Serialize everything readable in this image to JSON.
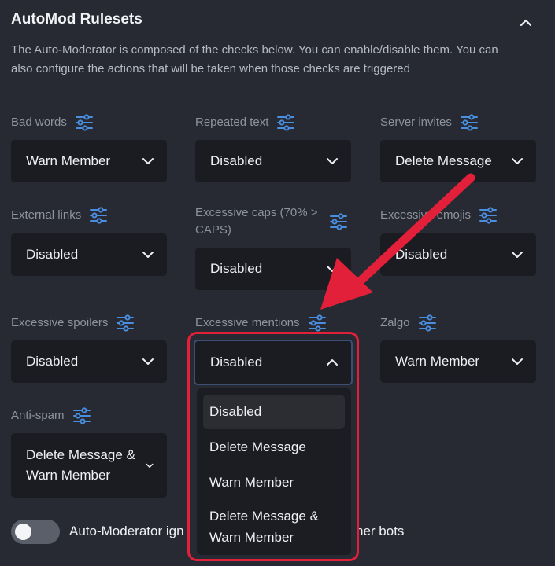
{
  "header": {
    "title": "AutoMod Rulesets",
    "description": "The Auto-Moderator is composed of the checks below. You can enable/disable them. You can also configure the actions that will be taken when those checks are triggered"
  },
  "rules": [
    {
      "id": "bad-words",
      "label": "Bad words",
      "value": "Warn Member"
    },
    {
      "id": "repeated-text",
      "label": "Repeated text",
      "value": "Disabled"
    },
    {
      "id": "server-invites",
      "label": "Server invites",
      "value": "Delete Message"
    },
    {
      "id": "external-links",
      "label": "External links",
      "value": "Disabled"
    },
    {
      "id": "excessive-caps",
      "label": "Excessive caps (70% > CAPS)",
      "value": "Disabled"
    },
    {
      "id": "excessive-emojis",
      "label": "Excessive emojis",
      "value": "Disabled"
    },
    {
      "id": "excessive-spoilers",
      "label": "Excessive spoilers",
      "value": "Disabled"
    },
    {
      "id": "excessive-mentions",
      "label": "Excessive mentions",
      "value": "Disabled"
    },
    {
      "id": "zalgo",
      "label": "Zalgo",
      "value": "Warn Member"
    },
    {
      "id": "anti-spam",
      "label": "Anti-spam",
      "value": "Delete Message & Warn Member"
    }
  ],
  "dropdown_menu": {
    "options": [
      "Disabled",
      "Delete Message",
      "Warn Member",
      "Delete Message & Warn Member"
    ],
    "selected": "Disabled"
  },
  "toggle": {
    "label_start": "Auto-Moderator ign",
    "label_end": "ner bots",
    "enabled": false
  },
  "colors": {
    "background": "#272a33",
    "dropdown": "#1b1c21",
    "icon_accent": "#4a8ee0",
    "highlight": "#e3203a"
  },
  "icons": [
    "chevron-up-icon",
    "tune-icon",
    "chevron-down-icon",
    "arrow-annotation"
  ]
}
